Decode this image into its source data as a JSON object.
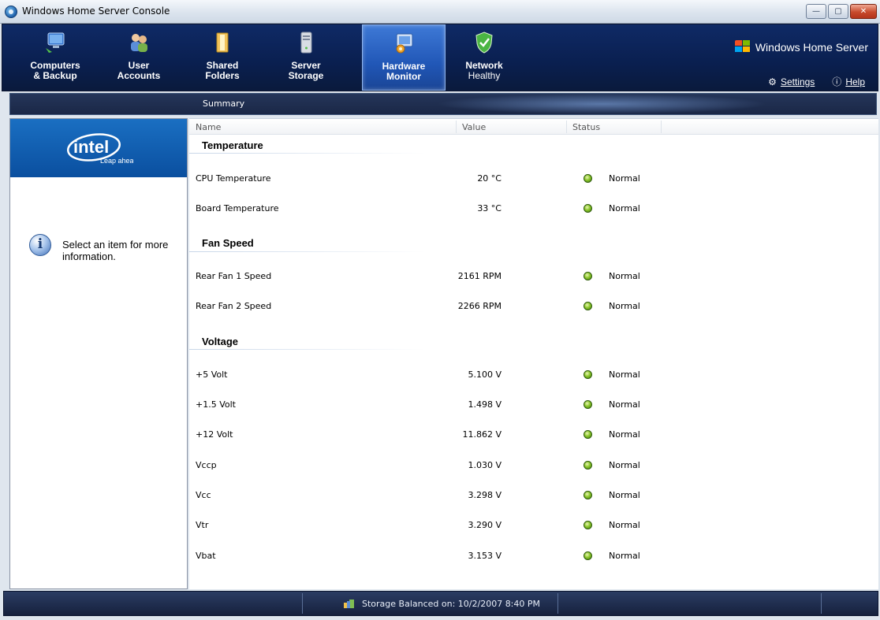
{
  "window": {
    "title": "Windows Home Server Console",
    "controls": [
      "minimize",
      "maximize",
      "close"
    ]
  },
  "nav": {
    "tabs": [
      {
        "label": "Computers\n& Backup",
        "icon": "computers-icon",
        "active": false
      },
      {
        "label": "User\nAccounts",
        "icon": "users-icon",
        "active": false
      },
      {
        "label": "Shared\nFolders",
        "icon": "shared-folders-icon",
        "active": false
      },
      {
        "label": "Server\nStorage",
        "icon": "server-storage-icon",
        "active": false
      },
      {
        "label": "Hardware\nMonitor",
        "icon": "hardware-monitor-icon",
        "active": true
      },
      {
        "label_top": "Network",
        "label_bottom": "Healthy",
        "icon": "network-shield-icon",
        "active": false
      }
    ],
    "brand": "Windows Home Server",
    "settings_label": "Settings",
    "help_label": "Help"
  },
  "subtab": {
    "summary": "Summary"
  },
  "left": {
    "logo_text": "intel",
    "logo_tagline": "Leap ahead",
    "info_message": "Select an item for more information."
  },
  "table": {
    "columns": {
      "name": "Name",
      "value": "Value",
      "status": "Status"
    },
    "sections": [
      {
        "title": "Temperature",
        "rows": [
          {
            "name": "CPU Temperature",
            "value": "20 °C",
            "status": "Normal"
          },
          {
            "name": "Board Temperature",
            "value": "33 °C",
            "status": "Normal"
          }
        ]
      },
      {
        "title": "Fan Speed",
        "rows": [
          {
            "name": "Rear Fan 1 Speed",
            "value": "2161 RPM",
            "status": "Normal"
          },
          {
            "name": "Rear Fan 2 Speed",
            "value": "2266 RPM",
            "status": "Normal"
          }
        ]
      },
      {
        "title": "Voltage",
        "rows": [
          {
            "name": "+5 Volt",
            "value": "5.100 V",
            "status": "Normal"
          },
          {
            "name": "+1.5 Volt",
            "value": "1.498 V",
            "status": "Normal"
          },
          {
            "name": "+12 Volt",
            "value": "11.862 V",
            "status": "Normal"
          },
          {
            "name": "Vccp",
            "value": "1.030 V",
            "status": "Normal"
          },
          {
            "name": "Vcc",
            "value": "3.298 V",
            "status": "Normal"
          },
          {
            "name": "Vtr",
            "value": "3.290 V",
            "status": "Normal"
          },
          {
            "name": "Vbat",
            "value": "3.153 V",
            "status": "Normal"
          }
        ]
      }
    ]
  },
  "statusbar": {
    "storage_text": "Storage Balanced on: 10/2/2007 8:40 PM"
  }
}
